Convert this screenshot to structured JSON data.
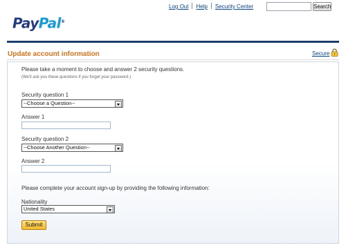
{
  "header": {
    "logo": {
      "part1": "Pay",
      "part2": "Pal",
      "mark": "®"
    },
    "links": [
      {
        "label": "Log Out"
      },
      {
        "label": "Help"
      },
      {
        "label": "Security Center"
      }
    ],
    "search": {
      "value": "",
      "placeholder": "",
      "button_label": "Search"
    }
  },
  "page": {
    "title": "Update account information",
    "secure_label": "Secure",
    "secure_icon": "lock-icon"
  },
  "form": {
    "intro": "Please take a moment to choose and answer 2 security questions.",
    "note": "(We'll ask you these questions if you forget your password.)",
    "question1": {
      "label": "Security question 1",
      "selected": "--Choose a Question--"
    },
    "answer1": {
      "label": "Answer 1",
      "value": ""
    },
    "question2": {
      "label": "Security question 2",
      "selected": "--Choose Another Question--"
    },
    "answer2": {
      "label": "Answer 2",
      "value": ""
    },
    "complete_text": "Please complete your account sign-up by providing the following information:",
    "nationality": {
      "label": "Nationality",
      "selected": "United States"
    },
    "submit_label": "Submit"
  },
  "colors": {
    "logo_dark": "#253b80",
    "logo_light": "#179bd7",
    "title_orange": "#d2731f",
    "link_blue": "#084482",
    "header_rule": "#1f3d6b",
    "submit_yellow": "#f6b82c"
  }
}
